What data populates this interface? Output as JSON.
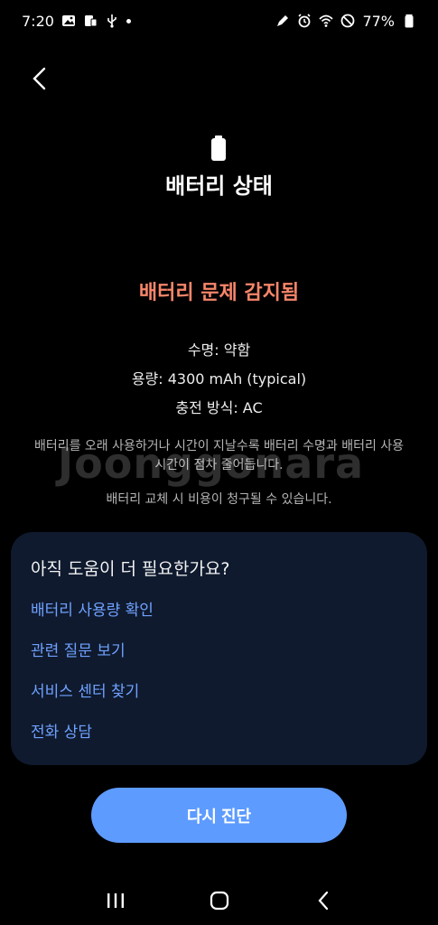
{
  "status_bar": {
    "time": "7:20",
    "battery_percent": "77%",
    "icons": [
      "gallery-icon",
      "screenshot-icon",
      "usb-icon",
      "dot-icon",
      "pen-icon",
      "alarm-icon",
      "wifi-icon",
      "dnd-icon",
      "battery-icon"
    ]
  },
  "header": {
    "title": "배터리 상태"
  },
  "status": {
    "alert": "배터리 문제 감지됨",
    "lifespan": "수명: 약함",
    "capacity": "용량: 4300 mAh (typical)",
    "charging": "충전 방식: AC"
  },
  "description": {
    "text1": "배터리를 오래 사용하거나 시간이 지날수록 배터리 수명과 배터리 사용 시간이 점차 줄어듭니다.",
    "text2": "배터리 교체 시 비용이 청구될 수 있습니다."
  },
  "watermark": "Joonggonara",
  "help": {
    "title": "아직 도움이 더 필요한가요?",
    "links": [
      "배터리 사용량 확인",
      "관련 질문 보기",
      "서비스 센터 찾기",
      "전화 상담"
    ]
  },
  "actions": {
    "retry": "다시 진단"
  },
  "colors": {
    "alert": "#f7866a",
    "link": "#6fa1ff",
    "card": "#0f1a2e",
    "button": "#5d9bff"
  }
}
